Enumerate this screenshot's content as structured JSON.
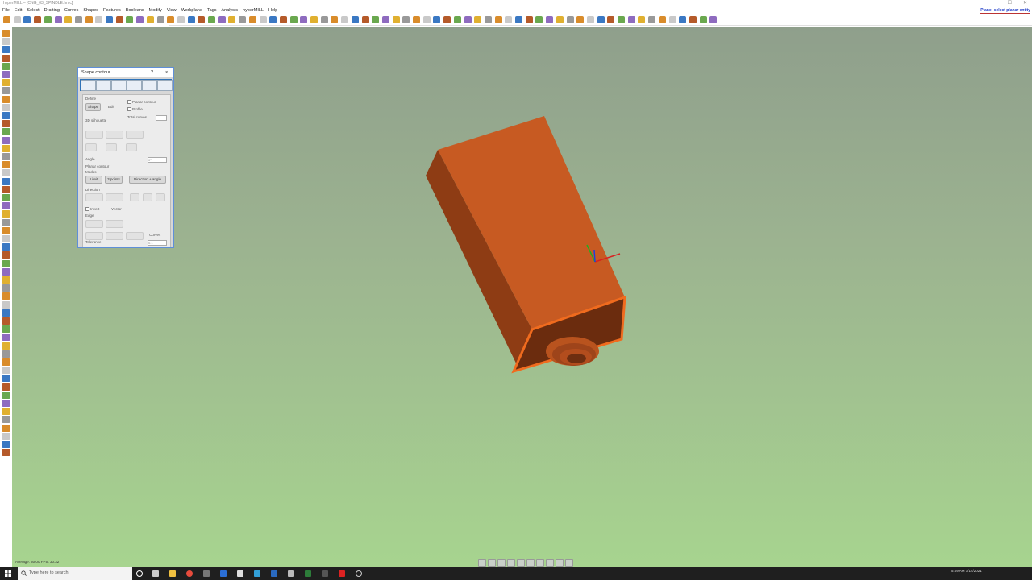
{
  "window": {
    "title": "hyperMILL – [CNG_03_SPINDLE.hmc]",
    "controls": [
      "–",
      "☐",
      "✕"
    ]
  },
  "menu": [
    "File",
    "Edit",
    "Select",
    "Drafting",
    "Curves",
    "Shapes",
    "Features",
    "Booleans",
    "Modify",
    "View",
    "Workplane",
    "Tags",
    "Analysis",
    "hyperMILL",
    "Help"
  ],
  "hint": "Plane: select planar entity",
  "dialog": {
    "title": "Shape contour",
    "help": "?",
    "close": "×",
    "section_define": "Define",
    "shape_btn": "Shape",
    "edit_btn": "Edit",
    "planar_contour": "Planar contour",
    "profile": "Profile",
    "total_curves": "Total curves",
    "silhouette": "3D silhouette",
    "angle_label": "Angle",
    "angle_value": "0°",
    "planar_contour_section": "Planar contour",
    "modes_label": "Modes",
    "mode_btns": [
      "Limit",
      "3 points",
      "Direction + angle"
    ],
    "direction_label": "Direction",
    "invert": "Invert",
    "vector": "Vector",
    "edge_label": "Edge",
    "curves_label": "Curves",
    "tolerance_label": "Tolerance",
    "tolerance_value": "0.1"
  },
  "status": {
    "fps": "Average: 30.00 FPS: 30.32"
  },
  "taskbar": {
    "search_placeholder": "Type here to search",
    "time": "5:09 AM",
    "date": "1/14/2021"
  },
  "colors": {
    "part": "#c75a22",
    "part_dark": "#8e3c14",
    "part_edge": "#f06b1e",
    "dialog_tabs": "#2f73b8",
    "hint": "#1f3cc9"
  }
}
